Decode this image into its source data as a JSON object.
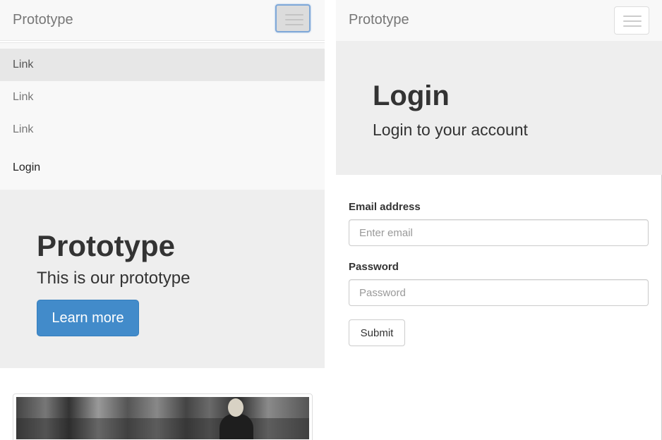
{
  "left": {
    "navbar": {
      "brand": "Prototype",
      "toggle_icon": "hamburger-icon"
    },
    "menu": {
      "items": [
        {
          "label": "Link"
        },
        {
          "label": "Link"
        },
        {
          "label": "Link"
        }
      ],
      "login_label": "Login"
    },
    "jumbotron": {
      "title": "Prototype",
      "subtitle": "This is our prototype",
      "button_label": "Learn more"
    }
  },
  "right": {
    "navbar": {
      "brand": "Prototype",
      "toggle_icon": "hamburger-icon"
    },
    "jumbotron": {
      "title": "Login",
      "subtitle": "Login to your account"
    },
    "form": {
      "email_label": "Email address",
      "email_placeholder": "Enter email",
      "password_label": "Password",
      "password_placeholder": "Password",
      "submit_label": "Submit"
    }
  },
  "colors": {
    "primary": "#428bca",
    "navbar_bg": "#f8f8f8",
    "jumbotron_bg": "#eeeeee",
    "active_link_bg": "#e7e7e7"
  }
}
